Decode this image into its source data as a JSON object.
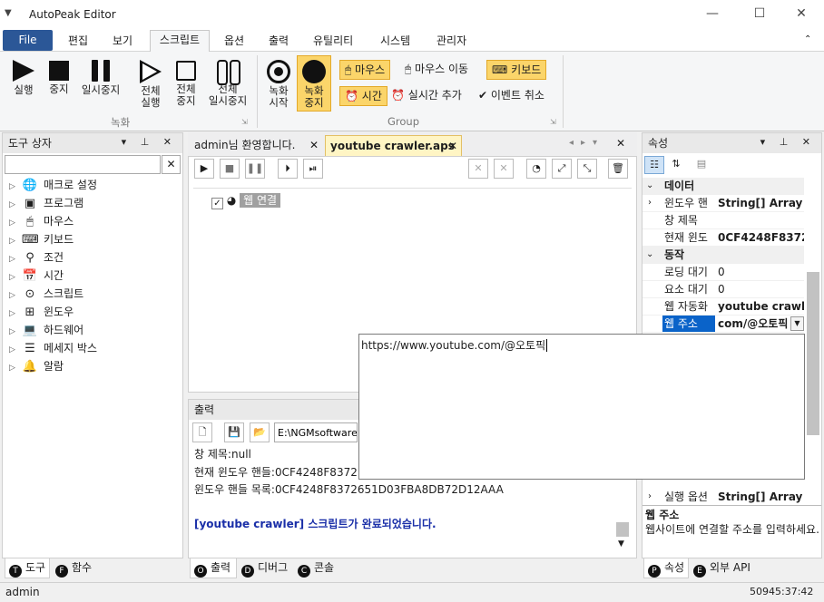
{
  "app": {
    "title": "AutoPeak Editor",
    "window_controls": [
      "minimize-icon",
      "maximize-icon",
      "close-icon"
    ]
  },
  "menu": {
    "file": "File",
    "items": [
      "편집",
      "보기",
      "스크립트",
      "옵션",
      "출력",
      "유틸리티",
      "시스템",
      "관리자"
    ],
    "active": "스크립트"
  },
  "ribbon": {
    "record_group": {
      "label": "녹화",
      "buttons": [
        "실행",
        "중지",
        "일시중지",
        "전체\n실행",
        "전체\n중지",
        "전체\n일시중지"
      ]
    },
    "group_group": {
      "label": "Group",
      "buttons": [
        "녹화\n시작",
        "녹화\n중지"
      ],
      "small": [
        "마우스",
        "마우스 이동",
        "키보드",
        "시간",
        "실시간 추가",
        "이벤트 취소"
      ]
    }
  },
  "toolbox": {
    "title": "도구 상자",
    "search_placeholder": "",
    "items": [
      "매크로 설정",
      "프로그램",
      "마우스",
      "키보드",
      "조건",
      "시간",
      "스크립트",
      "윈도우",
      "하드웨어",
      "메세지 박스",
      "알람"
    ],
    "tabs": [
      "도구",
      "함수"
    ],
    "tab_badges": [
      "T",
      "F"
    ]
  },
  "docs": {
    "tabs": [
      "admin님 환영합니다.",
      "youtube crawler.aps"
    ],
    "active_tab": "youtube crawler.aps",
    "node_label": "웹 연결"
  },
  "output": {
    "title": "출력",
    "path": "E:\\NGMsoftware\\",
    "lines": [
      "창 제목:null",
      "현재 윈도우 핸들:0CF4248F8372",
      "윈도우 핸들 목록:0CF4248F8372651D03FBA8DB72D12AAA",
      "",
      "[youtube crawler] 스크립트가 완료되었습니다."
    ],
    "tabs": [
      "출력",
      "디버그",
      "콘솔"
    ],
    "tab_badges": [
      "O",
      "D",
      "C"
    ]
  },
  "properties": {
    "title": "속성",
    "rows": [
      {
        "type": "cat",
        "label": "데이터"
      },
      {
        "type": "row",
        "k": "윈도우 핸",
        "v": "String[] Array",
        "expand": true
      },
      {
        "type": "row",
        "k": "창 제목",
        "v": ""
      },
      {
        "type": "row",
        "k": "현재 윈도",
        "v": "0CF4248F837265"
      },
      {
        "type": "cat",
        "label": "동작"
      },
      {
        "type": "row",
        "k": "로딩 대기",
        "v": "0"
      },
      {
        "type": "row",
        "k": "요소 대기",
        "v": "0"
      },
      {
        "type": "row",
        "k": "웹 자동화",
        "v": "youtube crawler"
      },
      {
        "type": "sel",
        "k": "웹 주소",
        "v": "com/@오토픽"
      }
    ],
    "bottom_rows": [
      {
        "k": "실행 옵션",
        "v": "String[] Array"
      }
    ],
    "desc_title": "웹 주소",
    "desc_text": "웹사이트에 연결할 주소를 입력하세요.",
    "tabs": [
      "속성",
      "외부 API"
    ],
    "tab_badges": [
      "P",
      "E"
    ]
  },
  "url_editor": {
    "value": "https://www.youtube.com/@오토픽"
  },
  "status": {
    "left": "admin",
    "right": "50945:37:42"
  }
}
